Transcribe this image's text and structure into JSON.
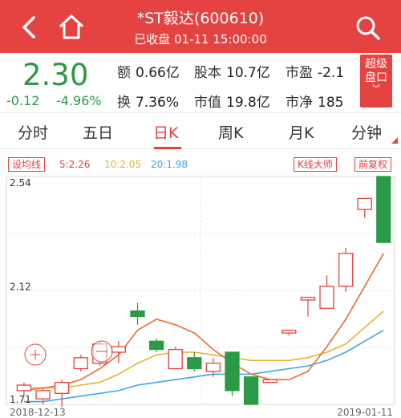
{
  "header": {
    "title": "*ST毅达(600610)",
    "subtitle": "已收盘 01-11 15:00:00",
    "back_icon": "back-arrow-icon",
    "home_icon": "home-icon",
    "search_icon": "search-icon"
  },
  "quote": {
    "price": "2.30",
    "change": "-0.12",
    "change_pct": "-4.96%",
    "stats": [
      {
        "k": "额",
        "v": "0.66亿"
      },
      {
        "k": "股本",
        "v": "10.7亿"
      },
      {
        "k": "市盈",
        "v": "-2.1"
      },
      {
        "k": "换",
        "v": "7.36%"
      },
      {
        "k": "市值",
        "v": "19.8亿"
      },
      {
        "k": "市净",
        "v": "185"
      }
    ],
    "level2": {
      "line1": "超级",
      "line2": "盘口"
    }
  },
  "tabs": [
    "分时",
    "五日",
    "日K",
    "周K",
    "月K",
    "分钟"
  ],
  "active_tab": "日K",
  "toolbar": {
    "ma_settings": "设均线",
    "ma5": "5:2.26",
    "ma10": "10:2.05",
    "ma20": "20:1.98",
    "master": "K线大师",
    "adjust": "前复权"
  },
  "colors": {
    "up": "#e54242",
    "down": "#2a9a46",
    "ma5": "#f26c2b",
    "ma10": "#e8b22f",
    "ma20": "#3ea6e6"
  },
  "chart_data": {
    "type": "candlestick",
    "y_labels": [
      "2.54",
      "2.12",
      "1.71"
    ],
    "x_labels": [
      "2018-12-13",
      "2019-01-11"
    ],
    "ylim": [
      1.71,
      2.54
    ],
    "candles": [
      {
        "o": 1.76,
        "c": 1.78,
        "h": 1.79,
        "l": 1.74
      },
      {
        "o": 1.73,
        "c": 1.76,
        "h": 1.77,
        "l": 1.71
      },
      {
        "o": 1.75,
        "c": 1.79,
        "h": 1.8,
        "l": 1.7
      },
      {
        "o": 1.84,
        "c": 1.88,
        "h": 1.89,
        "l": 1.83
      },
      {
        "o": 1.86,
        "c": 1.93,
        "h": 1.94,
        "l": 1.85
      },
      {
        "o": 1.9,
        "c": 1.92,
        "h": 1.94,
        "l": 1.86
      },
      {
        "o": 2.05,
        "c": 2.03,
        "h": 2.08,
        "l": 2.0
      },
      {
        "o": 1.94,
        "c": 1.91,
        "h": 1.95,
        "l": 1.9
      },
      {
        "o": 1.84,
        "c": 1.91,
        "h": 1.92,
        "l": 1.84
      },
      {
        "o": 1.88,
        "c": 1.84,
        "h": 1.9,
        "l": 1.83
      },
      {
        "o": 1.83,
        "c": 1.86,
        "h": 1.88,
        "l": 1.81
      },
      {
        "o": 1.9,
        "c": 1.76,
        "h": 1.9,
        "l": 1.74
      },
      {
        "o": 1.81,
        "c": 1.71,
        "h": 1.81,
        "l": 1.71
      },
      {
        "o": 1.79,
        "c": 1.8,
        "h": 1.8,
        "l": 1.79
      },
      {
        "o": 1.97,
        "c": 1.98,
        "h": 1.98,
        "l": 1.96
      },
      {
        "o": 2.09,
        "c": 2.1,
        "h": 2.1,
        "l": 2.03
      },
      {
        "o": 2.06,
        "c": 2.14,
        "h": 2.18,
        "l": 2.06
      },
      {
        "o": 2.14,
        "c": 2.26,
        "h": 2.28,
        "l": 2.12
      },
      {
        "o": 2.42,
        "c": 2.46,
        "h": 2.46,
        "l": 2.39
      },
      {
        "o": 2.54,
        "c": 2.3,
        "h": 2.54,
        "l": 2.3
      }
    ],
    "ma5": [
      1.76,
      1.77,
      1.78,
      1.8,
      1.84,
      1.89,
      1.98,
      2.02,
      2.0,
      1.97,
      1.91,
      1.86,
      1.82,
      1.8,
      1.8,
      1.83,
      1.92,
      2.02,
      2.14,
      2.26
    ],
    "ma10": [
      1.77,
      1.77,
      1.77,
      1.78,
      1.79,
      1.82,
      1.86,
      1.89,
      1.9,
      1.9,
      1.89,
      1.88,
      1.87,
      1.87,
      1.87,
      1.88,
      1.9,
      1.93,
      1.99,
      2.05
    ],
    "ma20": [
      1.72,
      1.72,
      1.73,
      1.74,
      1.75,
      1.76,
      1.78,
      1.79,
      1.8,
      1.81,
      1.82,
      1.82,
      1.82,
      1.83,
      1.84,
      1.85,
      1.87,
      1.9,
      1.94,
      1.98
    ]
  }
}
